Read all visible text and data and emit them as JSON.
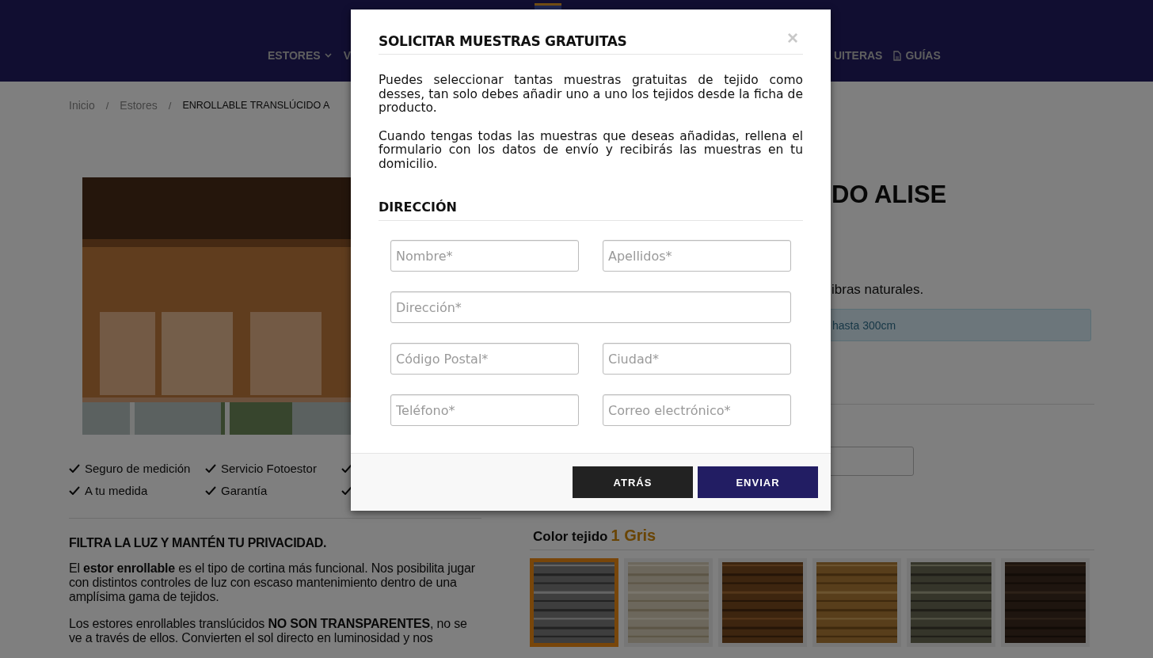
{
  "header": {
    "nav_left": [
      {
        "label": "ESTORES",
        "kind": "dropdown"
      },
      {
        "label": "V",
        "kind": "link"
      }
    ],
    "nav_right": [
      {
        "label": "UITERAS",
        "kind": "link"
      },
      {
        "label": "GUÍAS",
        "kind": "document"
      }
    ]
  },
  "breadcrumb": [
    {
      "kind": "link",
      "label": "Inicio",
      "current": false
    },
    {
      "kind": "separator",
      "label": "/"
    },
    {
      "kind": "link",
      "label": "Estores",
      "current": false
    },
    {
      "kind": "separator",
      "label": "/"
    },
    {
      "kind": "link",
      "label": "ENROLLABLE TRANSLÚCIDO A",
      "current": true
    }
  ],
  "features": [
    {
      "kind": "text",
      "label": "Seguro de medición"
    },
    {
      "kind": "text",
      "label": "Servicio Fotoestor"
    },
    {
      "kind": "check_only"
    },
    {
      "kind": "text",
      "label": "A tu medida"
    },
    {
      "kind": "text",
      "label": "Garantía"
    },
    {
      "kind": "check_only"
    }
  ],
  "description": {
    "heading": "FILTRA LA LUZ Y MANTÉN TU PRIVACIDAD.",
    "paragraphs": [
      "El **estor enrollable** es el tipo de cortina más funcional. Nos posibilita jugar con distintos controles de luz con escaso mantenimiento dentro de una amplísima gama de tejidos.",
      "Los estores enrollables translúcidos **NO SON TRANSPARENTES**, no se ve a través de ellos. Convierten el sol directo en luminosidad y nos"
    ]
  },
  "product": {
    "title": "DO ALISE",
    "subtitle": "ibras naturales.",
    "info": "hasta 300cm",
    "color_label": "Color tejido",
    "color_value": "1 Gris",
    "swatches": [
      {
        "selected": true
      },
      {
        "selected": false
      },
      {
        "selected": false
      },
      {
        "selected": false
      },
      {
        "selected": false
      },
      {
        "selected": false
      }
    ]
  },
  "modal": {
    "title": "SOLICITAR MUESTRAS GRATUITAS",
    "close": "×",
    "paragraphs": [
      "Puedes seleccionar tantas muestras gratuitas de tejido como desses, tan solo debes añadir uno a uno los tejidos desde la ficha de producto.",
      "Cuando tengas todas las muestras que deseas añadidas, rellena el formulario con los datos de envío y recibirás las muestras en tu domicilio."
    ],
    "section": "DIRECCIÓN",
    "fields": [
      {
        "placeholder": "Nombre*",
        "kind": "half"
      },
      {
        "placeholder": "Apellidos*",
        "kind": "half"
      },
      {
        "placeholder": "Dirección*",
        "kind": "wide"
      },
      {
        "placeholder": "Código Postal*",
        "kind": "half"
      },
      {
        "placeholder": "Ciudad*",
        "kind": "half"
      },
      {
        "placeholder": "Teléfono*",
        "kind": "half"
      },
      {
        "placeholder": "Correo electrónico*",
        "kind": "half"
      }
    ],
    "buttons": [
      {
        "label": "ATRÁS",
        "kind": "secondary"
      },
      {
        "label": "ENVIAR",
        "kind": "primary"
      }
    ]
  }
}
